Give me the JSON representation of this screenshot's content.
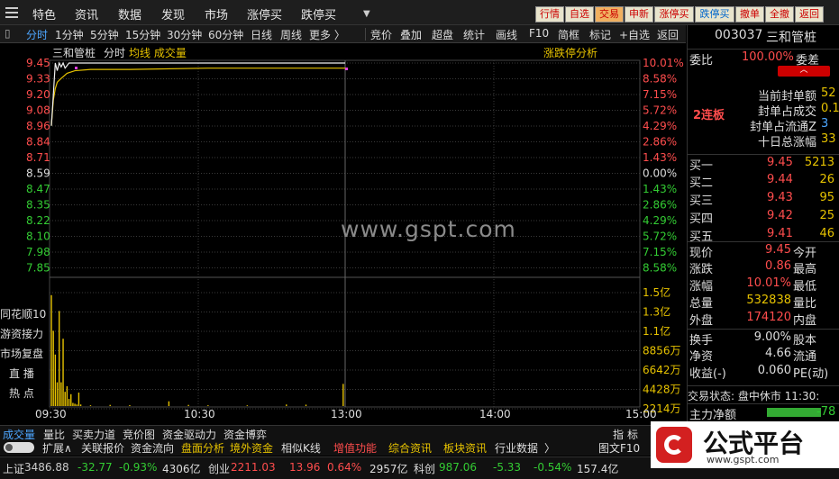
{
  "topbar": {
    "menu": [
      "特色",
      "资讯",
      "数据",
      "发现",
      "市场",
      "涨停买",
      "跌停买"
    ],
    "buttons": [
      "行情",
      "自选",
      "交易",
      "申新",
      "涨停买",
      "跌停买",
      "撤单",
      "全撤",
      "返回"
    ]
  },
  "subbar": {
    "left": [
      "分时",
      "1分钟",
      "5分钟",
      "15分钟",
      "30分钟",
      "60分钟",
      "日线",
      "周线",
      "更多 〉"
    ],
    "right": [
      "竞价",
      "叠加",
      "超盘",
      "统计",
      "画线",
      "F10",
      "简框",
      "标记",
      "+自选",
      "返回"
    ]
  },
  "chart_header": {
    "name": "三和管桩",
    "mode": "分时",
    "indicators": "均线 成交量",
    "analysis": "涨跌停分析"
  },
  "chart_data": {
    "type": "line",
    "price_ticks": [
      "9.45",
      "9.33",
      "9.20",
      "9.08",
      "8.96",
      "8.84",
      "8.71",
      "8.59",
      "8.47",
      "8.35",
      "8.22",
      "8.10",
      "7.98",
      "7.85"
    ],
    "pct_ticks": [
      "10.01%",
      "8.58%",
      "7.15%",
      "5.72%",
      "4.29%",
      "2.86%",
      "1.43%",
      "0.00%",
      "1.43%",
      "2.86%",
      "4.29%",
      "5.72%",
      "7.15%",
      "8.58%"
    ],
    "vol_ticks": [
      "1.5亿",
      "1.3亿",
      "1.1亿",
      "8856万",
      "6642万",
      "4428万",
      "2214万"
    ],
    "time_ticks": [
      "09:30",
      "10:30",
      "13:00",
      "14:00",
      "15:00"
    ],
    "ylim": [
      7.73,
      9.45
    ],
    "prev_close": 8.59,
    "price": [
      [
        0,
        8.96
      ],
      [
        1,
        9.2
      ],
      [
        2,
        9.45
      ],
      [
        3,
        9.39
      ],
      [
        4,
        9.45
      ],
      [
        5,
        9.42
      ],
      [
        6,
        9.45
      ],
      [
        7,
        9.41
      ],
      [
        8,
        9.43
      ],
      [
        9,
        9.45
      ],
      [
        10,
        9.45
      ],
      [
        15,
        9.45
      ],
      [
        60,
        9.45
      ],
      [
        120,
        9.45
      ],
      [
        150,
        9.45
      ]
    ],
    "avg": [
      [
        0,
        8.96
      ],
      [
        1,
        9.16
      ],
      [
        2,
        9.25
      ],
      [
        3,
        9.3
      ],
      [
        5,
        9.33
      ],
      [
        8,
        9.37
      ],
      [
        12,
        9.39
      ],
      [
        20,
        9.4
      ],
      [
        40,
        9.4
      ],
      [
        80,
        9.41
      ],
      [
        120,
        9.41
      ],
      [
        150,
        9.41
      ]
    ],
    "volume": [
      [
        0,
        14000
      ],
      [
        1,
        9500
      ],
      [
        2,
        6500
      ],
      [
        3,
        3000
      ],
      [
        4,
        12000
      ],
      [
        5,
        3000
      ],
      [
        6,
        8500
      ],
      [
        7,
        1800
      ],
      [
        8,
        2500
      ],
      [
        9,
        900
      ],
      [
        10,
        1500
      ],
      [
        11,
        400
      ],
      [
        12,
        300
      ],
      [
        13,
        200
      ],
      [
        14,
        1700
      ],
      [
        15,
        200
      ],
      [
        20,
        100
      ],
      [
        30,
        150
      ],
      [
        40,
        120
      ],
      [
        60,
        600
      ],
      [
        70,
        150
      ],
      [
        80,
        100
      ],
      [
        100,
        90
      ],
      [
        120,
        200
      ],
      [
        130,
        180
      ],
      [
        149,
        2800
      ]
    ]
  },
  "left_labels": [
    "同花顺10",
    "游资接力",
    "市场复盘",
    "直 播",
    "热 点"
  ],
  "watermark": "www.gspt.com",
  "right": {
    "code": "003037",
    "name": "三和管桩",
    "webi_label": "委比",
    "webi": "100.00%",
    "weicha_label": "委差",
    "stats": [
      [
        "当前封单额",
        "52"
      ],
      [
        "封单占成交",
        "0.1"
      ],
      [
        "封单占流通Z",
        "3"
      ],
      [
        "十日总涨幅",
        "33"
      ]
    ],
    "lianban": "2连板",
    "bids": [
      [
        "买一",
        "9.45",
        "5213"
      ],
      [
        "买二",
        "9.44",
        "26"
      ],
      [
        "买三",
        "9.43",
        "95"
      ],
      [
        "买四",
        "9.42",
        "25"
      ],
      [
        "买五",
        "9.41",
        "46"
      ]
    ],
    "quote": [
      [
        "现价",
        "9.45",
        "今开",
        ""
      ],
      [
        "涨跌",
        "0.86",
        "最高",
        ""
      ],
      [
        "涨幅",
        "10.01%",
        "最低",
        ""
      ],
      [
        "总量",
        "532838",
        "量比",
        ""
      ],
      [
        "外盘",
        "174120",
        "内盘",
        ""
      ]
    ],
    "quote2": [
      [
        "换手",
        "9.00%",
        "股本"
      ],
      [
        "净资",
        "4.66",
        "流通"
      ],
      [
        "收益(-)",
        "0.060",
        "PE(动)"
      ]
    ],
    "status": "交易状态: 盘中休市 11:30:",
    "main_flow_label": "主力净额",
    "main_flow": "-78"
  },
  "bottom_tabs": [
    "成交量",
    "量比",
    "买卖力道",
    "竞价图",
    "资金驱动力",
    "资金博弈"
  ],
  "bottom_right": [
    "指",
    "标"
  ],
  "bottom_bar2": [
    "扩展∧",
    "关联报价",
    "资金流向",
    "盘面分析",
    "境外资金",
    "相似K线",
    "增值功能",
    "综合资讯",
    "板块资讯",
    "行业数据",
    "〉"
  ],
  "bottom_bar2_right": "图文F10",
  "ticker": [
    {
      "name": "上证",
      "val": "3486.88",
      "chg": "-32.77",
      "pct": "-0.93%",
      "amt": "4306亿"
    },
    {
      "name": "创业",
      "val": "2211.03",
      "chg": "13.96",
      "pct": "0.64%",
      "amt": "2957亿"
    },
    {
      "name": "科创",
      "val": "987.06",
      "chg": "-5.33",
      "pct": "-0.54%",
      "amt": "157.4亿"
    }
  ],
  "logo": {
    "text": "公式平台",
    "url": "www.gspt.com"
  }
}
